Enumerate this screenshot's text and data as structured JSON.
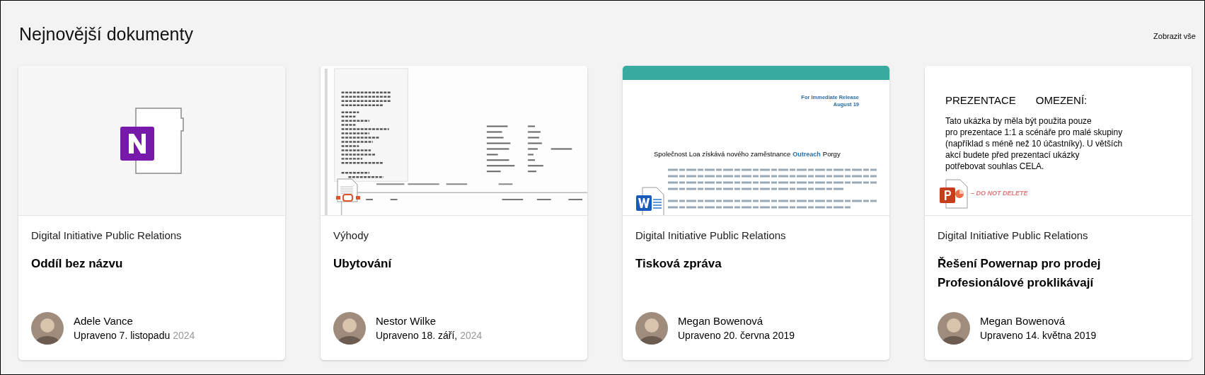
{
  "header": {
    "title": "Nejnovější dokumenty",
    "view_all": "Zobrazit vše"
  },
  "documents": [
    {
      "preview": {
        "kind": "notebook"
      },
      "site": "Digital Initiative Public Relations",
      "title": "Oddíl bez názvu",
      "author": "Adele Vance",
      "modified": "Upraveno 7. listopadu",
      "modified_faded": "2024"
    },
    {
      "preview": {
        "kind": "scan"
      },
      "site": "Výhody",
      "title": "Ubytování",
      "author": "Nestor Wilke",
      "modified": "Upraveno 18. září,",
      "modified_faded": "2024"
    },
    {
      "preview": {
        "kind": "document",
        "release": "For Immediate Release",
        "date": "August 19",
        "headline": "Společnost Loa získává nového zaměstnance",
        "headline_accent": "Outreach",
        "headline_end": "Porgy"
      },
      "site": "Digital Initiative Public Relations",
      "title": "Tisková zpráva",
      "author": "Megan Bowenová",
      "modified": "Upraveno 20. června 2019"
    },
    {
      "preview": {
        "kind": "slide",
        "heading_1": "PREZENTACE",
        "heading_2": "OMEZENÍ:",
        "body_lines": [
          "Tato ukázka by měla být použita pouze",
          "pro prezentace 1:1 a scénáře pro malé skupiny",
          "(například s méně než 10 účastníky). U větších",
          "akcí budete před prezentací ukázky",
          "potřebovat souhlas CELA."
        ],
        "footer": "– DO NOT DELETE"
      },
      "site": "Digital Initiative Public Relations",
      "title": "Řešení Powernap pro prodej Profesionálové proklikávají",
      "author": "Megan Bowenová",
      "modified": "Upraveno 14. května 2019"
    }
  ]
}
